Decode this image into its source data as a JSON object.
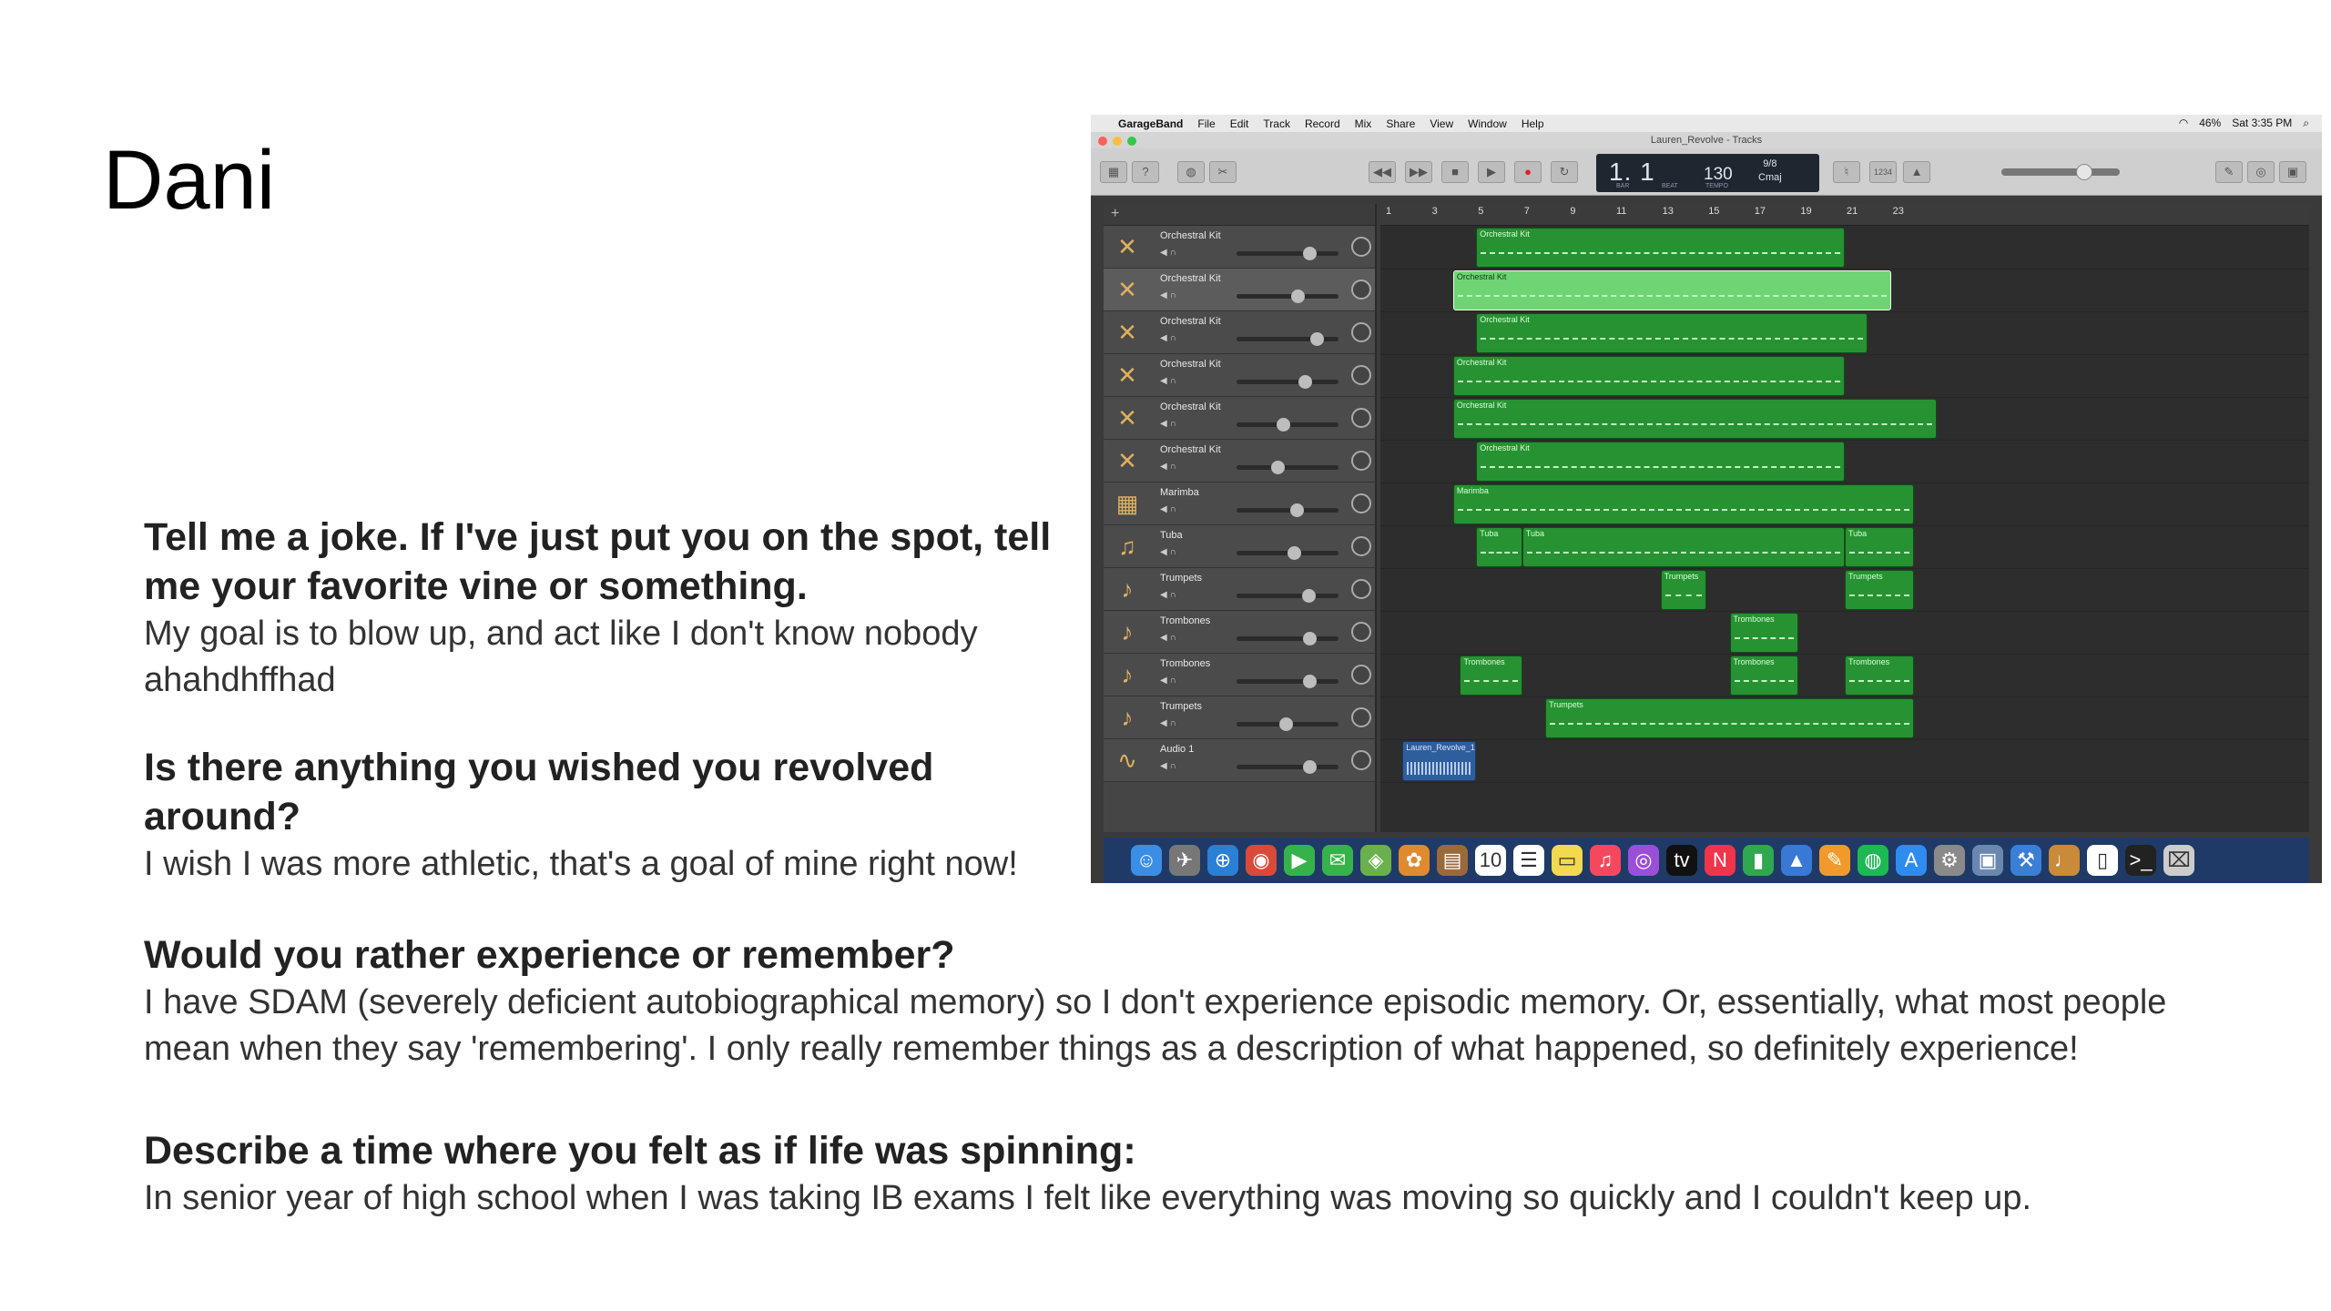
{
  "slide": {
    "title": "Dani"
  },
  "qa": [
    {
      "question": "Tell me a joke. If I've just put you on the spot, tell me your favorite vine or something.",
      "answer": "My goal is to blow up, and act like I don't know nobody ahahdhffhad"
    },
    {
      "question": "Is there anything you wished you revolved around?",
      "answer": "I wish I was more athletic, that's a goal of mine right now!"
    },
    {
      "question": "Would you rather experience or remember?",
      "answer": "I have SDAM (severely deficient autobiographical memory) so I don't experience episodic memory. Or, essentially, what most people mean when they say 'remembering'. I only really remember things as a description of what happened, so definitely experience!"
    },
    {
      "question": "Describe a time where you felt as if life was spinning:",
      "answer": "In senior year of high school when I was taking IB exams I felt like everything was moving so quickly and I couldn't keep up."
    }
  ],
  "screenshot": {
    "menubar": {
      "apple": "",
      "app": "GarageBand",
      "items": [
        "File",
        "Edit",
        "Track",
        "Record",
        "Mix",
        "Share",
        "View",
        "Window",
        "Help"
      ],
      "battery": "46%",
      "clock": "Sat 3:35 PM"
    },
    "window_title": "Lauren_Revolve - Tracks",
    "lcd": {
      "position": "1. 1",
      "bar_label": "BAR",
      "beat_label": "BEAT",
      "tempo": "130",
      "tempo_label": "TEMPO",
      "time_signature": "9/8",
      "key": "Cmaj",
      "count_in": "1234"
    },
    "ruler": [
      "1",
      "3",
      "5",
      "7",
      "9",
      "11",
      "13",
      "15",
      "17",
      "19",
      "21",
      "23"
    ],
    "tracks": [
      {
        "name": "Orchestral Kit",
        "icon": "drumsticks-icon",
        "glyph": "✕",
        "volume": 0.75,
        "selected": false
      },
      {
        "name": "Orchestral Kit",
        "icon": "drumsticks-icon",
        "glyph": "✕",
        "volume": 0.62,
        "selected": true
      },
      {
        "name": "Orchestral Kit",
        "icon": "drumsticks-icon",
        "glyph": "✕",
        "volume": 0.83,
        "selected": false
      },
      {
        "name": "Orchestral Kit",
        "icon": "drumsticks-icon",
        "glyph": "✕",
        "volume": 0.7,
        "selected": false
      },
      {
        "name": "Orchestral Kit",
        "icon": "drumsticks-icon",
        "glyph": "✕",
        "volume": 0.45,
        "selected": false
      },
      {
        "name": "Orchestral Kit",
        "icon": "drumsticks-icon",
        "glyph": "✕",
        "volume": 0.39,
        "selected": false
      },
      {
        "name": "Marimba",
        "icon": "marimba-icon",
        "glyph": "▦",
        "volume": 0.61,
        "selected": false
      },
      {
        "name": "Tuba",
        "icon": "tuba-icon",
        "glyph": "♫",
        "volume": 0.58,
        "selected": false
      },
      {
        "name": "Trumpets",
        "icon": "trumpet-icon",
        "glyph": "♪",
        "volume": 0.74,
        "selected": false
      },
      {
        "name": "Trombones",
        "icon": "trombone-icon",
        "glyph": "♪",
        "volume": 0.75,
        "selected": false
      },
      {
        "name": "Trombones",
        "icon": "trombone-icon",
        "glyph": "♪",
        "volume": 0.75,
        "selected": false
      },
      {
        "name": "Trumpets",
        "icon": "trumpet-icon",
        "glyph": "♪",
        "volume": 0.48,
        "selected": false
      },
      {
        "name": "Audio 1",
        "icon": "waveform-icon",
        "glyph": "∿",
        "volume": 0.75,
        "selected": false
      }
    ],
    "regions": [
      {
        "track": 0,
        "label": "Orchestral Kit",
        "start": 5,
        "end": 21.0,
        "selected": false,
        "audio": false
      },
      {
        "track": 1,
        "label": "Orchestral Kit",
        "start": 4,
        "end": 23.0,
        "selected": true,
        "audio": false
      },
      {
        "track": 2,
        "label": "Orchestral Kit",
        "start": 5,
        "end": 22.0,
        "selected": false,
        "audio": false
      },
      {
        "track": 3,
        "label": "Orchestral Kit",
        "start": 4,
        "end": 21.0,
        "selected": false,
        "audio": false
      },
      {
        "track": 4,
        "label": "Orchestral Kit",
        "start": 4,
        "end": 25.0,
        "selected": false,
        "audio": false
      },
      {
        "track": 5,
        "label": "Orchestral Kit",
        "start": 5,
        "end": 21.0,
        "selected": false,
        "audio": false
      },
      {
        "track": 6,
        "label": "Marimba",
        "start": 4,
        "end": 24.0,
        "selected": false,
        "audio": false
      },
      {
        "track": 7,
        "label": "Tuba",
        "start": 5,
        "end": 7.0,
        "selected": false,
        "audio": false
      },
      {
        "track": 7,
        "label": "Tuba",
        "start": 7,
        "end": 21.0,
        "selected": false,
        "audio": false
      },
      {
        "track": 7,
        "label": "Tuba",
        "start": 21,
        "end": 24.0,
        "selected": false,
        "audio": false
      },
      {
        "track": 8,
        "label": "Trumpets",
        "start": 13,
        "end": 15.0,
        "selected": false,
        "audio": false
      },
      {
        "track": 8,
        "label": "Trumpets",
        "start": 21,
        "end": 24.0,
        "selected": false,
        "audio": false
      },
      {
        "track": 9,
        "label": "Trombones",
        "start": 16,
        "end": 19.0,
        "selected": false,
        "audio": false
      },
      {
        "track": 10,
        "label": "Trombones",
        "start": 4.3,
        "end": 7.0,
        "selected": false,
        "audio": false
      },
      {
        "track": 10,
        "label": "Trombones",
        "start": 16,
        "end": 19.0,
        "selected": false,
        "audio": false
      },
      {
        "track": 10,
        "label": "Trombones",
        "start": 21,
        "end": 24.0,
        "selected": false,
        "audio": false
      },
      {
        "track": 11,
        "label": "Trumpets",
        "start": 8,
        "end": 24.0,
        "selected": false,
        "audio": false
      },
      {
        "track": 12,
        "label": "Lauren_Revolve_1",
        "start": 1.8,
        "end": 5.0,
        "selected": false,
        "audio": true
      }
    ],
    "dock": [
      {
        "name": "finder-icon",
        "glyph": "☺",
        "color": "#3a8ee6"
      },
      {
        "name": "launchpad-icon",
        "glyph": "✈",
        "color": "#777777"
      },
      {
        "name": "safari-icon",
        "glyph": "⊕",
        "color": "#2a7fd6"
      },
      {
        "name": "chrome-icon",
        "glyph": "◉",
        "color": "#d94a38"
      },
      {
        "name": "facetime-icon",
        "glyph": "▶",
        "color": "#35b34a"
      },
      {
        "name": "messages-icon",
        "glyph": "✉",
        "color": "#35b34a"
      },
      {
        "name": "maps-icon",
        "glyph": "◈",
        "color": "#6ab04c"
      },
      {
        "name": "photos-icon",
        "glyph": "✿",
        "color": "#e08a2e"
      },
      {
        "name": "notes-book-icon",
        "glyph": "▤",
        "color": "#9a6a3a"
      },
      {
        "name": "calendar-icon",
        "glyph": "10",
        "color": "#ffffff"
      },
      {
        "name": "reminders-icon",
        "glyph": "☰",
        "color": "#ffffff"
      },
      {
        "name": "stickies-icon",
        "glyph": "▭",
        "color": "#f2d94e"
      },
      {
        "name": "music-icon",
        "glyph": "♫",
        "color": "#f5485e"
      },
      {
        "name": "podcasts-icon",
        "glyph": "◎",
        "color": "#9b4fd8"
      },
      {
        "name": "appletv-icon",
        "glyph": "tv",
        "color": "#111111"
      },
      {
        "name": "news-icon",
        "glyph": "N",
        "color": "#f0344a"
      },
      {
        "name": "numbers-icon",
        "glyph": "▮",
        "color": "#2fa84f"
      },
      {
        "name": "keynote-icon",
        "glyph": "▲",
        "color": "#3a78d6"
      },
      {
        "name": "pages-icon",
        "glyph": "✎",
        "color": "#f19a2b"
      },
      {
        "name": "spotify-icon",
        "glyph": "◍",
        "color": "#1db954"
      },
      {
        "name": "appstore-icon",
        "glyph": "A",
        "color": "#2e8bf0"
      },
      {
        "name": "system-preferences-icon",
        "glyph": "⚙",
        "color": "#8a8a8a"
      },
      {
        "name": "preview-icon",
        "glyph": "▣",
        "color": "#6a87b0"
      },
      {
        "name": "xcode-icon",
        "glyph": "⚒",
        "color": "#3a7fd6"
      },
      {
        "name": "garageband-icon",
        "glyph": "♩",
        "color": "#c98a3a"
      },
      {
        "name": "textedit-icon",
        "glyph": "▯",
        "color": "#ffffff"
      },
      {
        "name": "terminal-icon",
        "glyph": ">_",
        "color": "#222222"
      },
      {
        "name": "trash-icon",
        "glyph": "⌧",
        "color": "#cccccc"
      }
    ]
  }
}
